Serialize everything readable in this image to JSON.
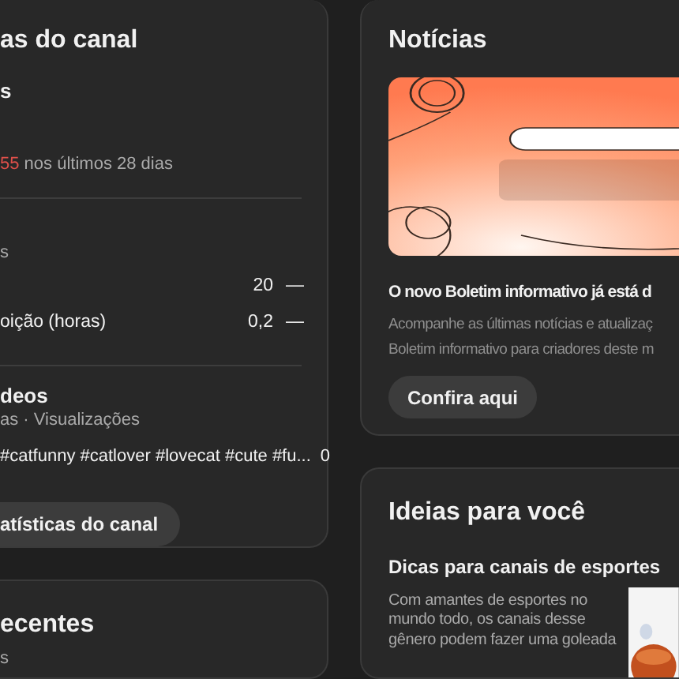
{
  "channel_stats": {
    "title": "as do canal",
    "subtitle": "s",
    "trend": {
      "value": "55",
      "suffix": " nos últimos 28 dias"
    },
    "summary_label": "s",
    "metrics": [
      {
        "value": "20",
        "change": "—"
      },
      {
        "label": "oição (horas)",
        "value": "0,2",
        "change": "—"
      }
    ],
    "videos_heading": "deos",
    "videos_caption": "as · Visualizações",
    "videos": [
      {
        "title": "#catfunny #catlover #lovecat #cute #fu...",
        "views": "0"
      }
    ],
    "button": "atísticas do canal"
  },
  "recent": {
    "title": "ecentes",
    "subtitle": "s"
  },
  "news": {
    "title": "Notícias",
    "banner": {
      "kind": "picture"
    },
    "headline": "O novo Boletim informativo já está d",
    "description": [
      "Acompanhe as últimas notícias e atualizaç",
      "Boletim informativo para criadores deste m"
    ],
    "button": "Confira aqui"
  },
  "ideas": {
    "title": "Ideias para você",
    "tip_title": "Dicas para canais de esportes",
    "tip_text": [
      "Com amantes de esportes no",
      "mundo todo, os canais desse",
      "gênero podem fazer uma goleada"
    ],
    "thumbnail": {
      "kind": "picture"
    }
  }
}
